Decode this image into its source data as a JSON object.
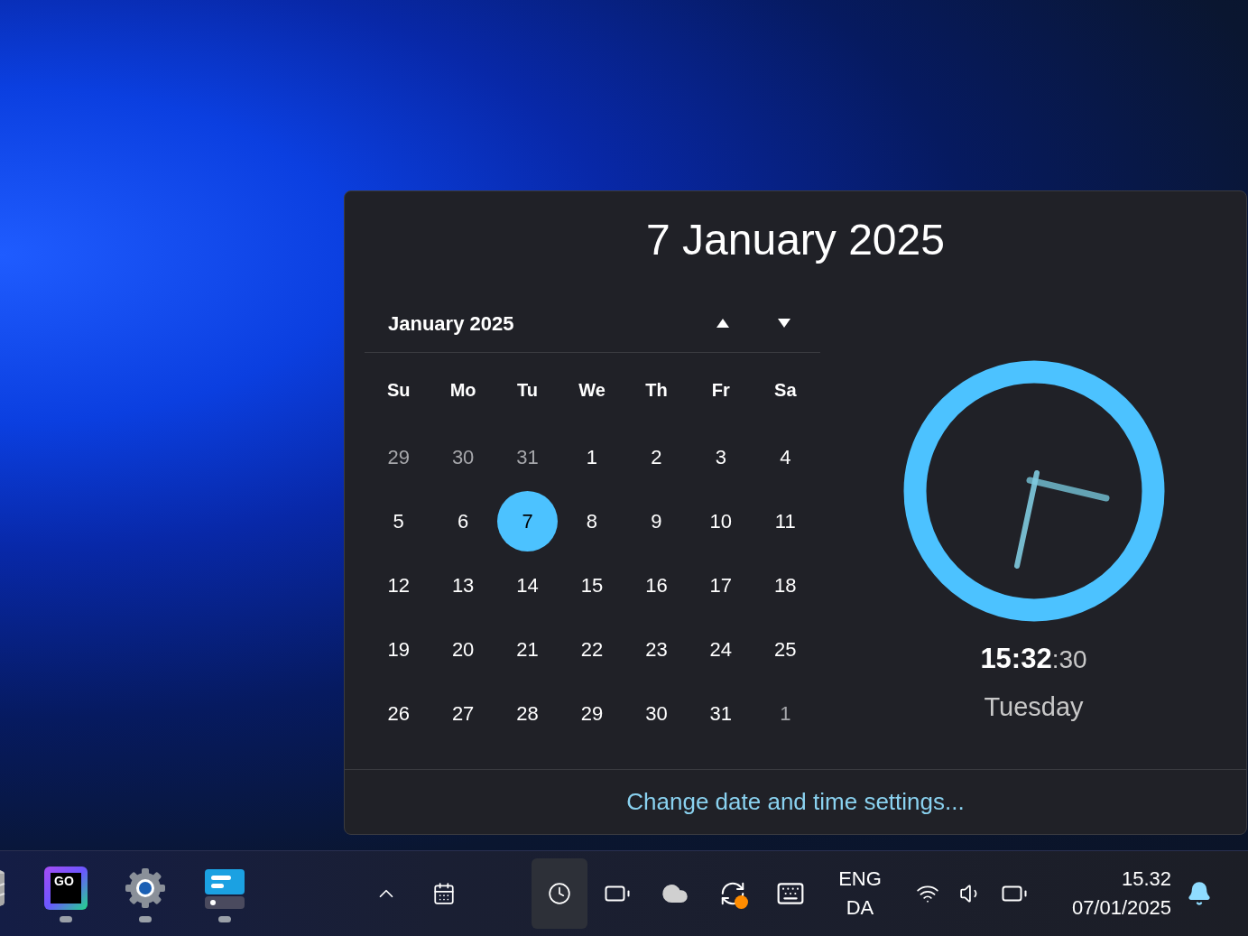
{
  "popup": {
    "title": "7 January 2025",
    "month_label": "January 2025",
    "weekdays": [
      "Su",
      "Mo",
      "Tu",
      "We",
      "Th",
      "Fr",
      "Sa"
    ],
    "weeks": [
      [
        {
          "day": "29",
          "outside": true,
          "selected": false
        },
        {
          "day": "30",
          "outside": true,
          "selected": false
        },
        {
          "day": "31",
          "outside": true,
          "selected": false
        },
        {
          "day": "1",
          "outside": false,
          "selected": false
        },
        {
          "day": "2",
          "outside": false,
          "selected": false
        },
        {
          "day": "3",
          "outside": false,
          "selected": false
        },
        {
          "day": "4",
          "outside": false,
          "selected": false
        }
      ],
      [
        {
          "day": "5",
          "outside": false,
          "selected": false
        },
        {
          "day": "6",
          "outside": false,
          "selected": false
        },
        {
          "day": "7",
          "outside": false,
          "selected": true
        },
        {
          "day": "8",
          "outside": false,
          "selected": false
        },
        {
          "day": "9",
          "outside": false,
          "selected": false
        },
        {
          "day": "10",
          "outside": false,
          "selected": false
        },
        {
          "day": "11",
          "outside": false,
          "selected": false
        }
      ],
      [
        {
          "day": "12",
          "outside": false,
          "selected": false
        },
        {
          "day": "13",
          "outside": false,
          "selected": false
        },
        {
          "day": "14",
          "outside": false,
          "selected": false
        },
        {
          "day": "15",
          "outside": false,
          "selected": false
        },
        {
          "day": "16",
          "outside": false,
          "selected": false
        },
        {
          "day": "17",
          "outside": false,
          "selected": false
        },
        {
          "day": "18",
          "outside": false,
          "selected": false
        }
      ],
      [
        {
          "day": "19",
          "outside": false,
          "selected": false
        },
        {
          "day": "20",
          "outside": false,
          "selected": false
        },
        {
          "day": "21",
          "outside": false,
          "selected": false
        },
        {
          "day": "22",
          "outside": false,
          "selected": false
        },
        {
          "day": "23",
          "outside": false,
          "selected": false
        },
        {
          "day": "24",
          "outside": false,
          "selected": false
        },
        {
          "day": "25",
          "outside": false,
          "selected": false
        }
      ],
      [
        {
          "day": "26",
          "outside": false,
          "selected": false
        },
        {
          "day": "27",
          "outside": false,
          "selected": false
        },
        {
          "day": "28",
          "outside": false,
          "selected": false
        },
        {
          "day": "29",
          "outside": false,
          "selected": false
        },
        {
          "day": "30",
          "outside": false,
          "selected": false
        },
        {
          "day": "31",
          "outside": false,
          "selected": false
        },
        {
          "day": "1",
          "outside": true,
          "selected": false
        }
      ]
    ],
    "clock": {
      "time_main": "15:32",
      "time_seconds": ":30",
      "weekday": "Tuesday"
    },
    "settings_link": "Change date and time settings..."
  },
  "taskbar": {
    "apps": [
      {
        "kind": "database"
      },
      {
        "kind": "goland",
        "label": "GO",
        "running": true
      },
      {
        "kind": "settings",
        "running": true
      },
      {
        "kind": "app",
        "running": true
      }
    ],
    "tray": [
      {
        "kind": "chevron",
        "selected": false
      },
      {
        "kind": "calendar",
        "selected": false
      },
      {
        "kind": "clock",
        "selected": true
      },
      {
        "kind": "battery",
        "selected": false
      },
      {
        "kind": "cloud",
        "selected": false
      },
      {
        "kind": "sync",
        "selected": false
      },
      {
        "kind": "keyboard",
        "selected": false
      }
    ],
    "language": [
      "ENG",
      "DA"
    ],
    "status": [
      {
        "kind": "wifi"
      },
      {
        "kind": "volume"
      },
      {
        "kind": "battery"
      }
    ],
    "time": "15.32",
    "date": "07/01/2025"
  }
}
